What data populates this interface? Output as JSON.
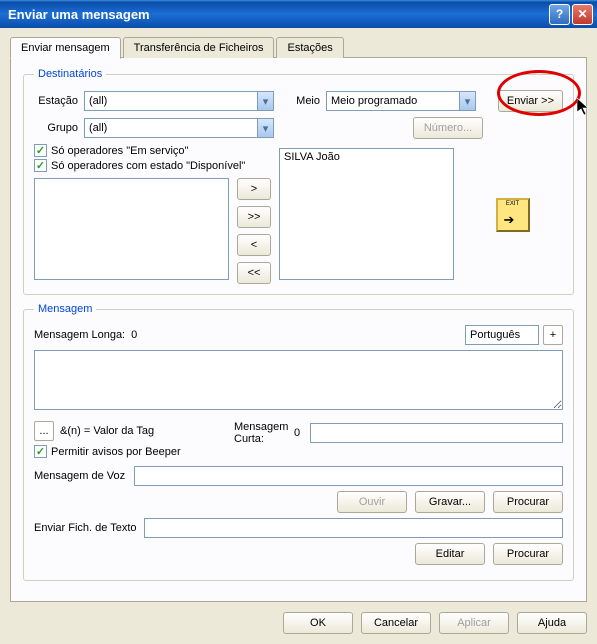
{
  "window": {
    "title": "Enviar uma mensagem"
  },
  "tabs": {
    "send": "Enviar mensagem",
    "transfer": "Transferência de Ficheiros",
    "stations": "Estações"
  },
  "dest": {
    "legend": "Destinatários",
    "station_label": "Estação",
    "station_value": "(all)",
    "group_label": "Grupo",
    "group_value": "(all)",
    "medium_label": "Meio",
    "medium_value": "Meio programado",
    "send_button": "Enviar >>",
    "number_button": "Número...",
    "chk_inservice": "Só operadores \"Em serviço\"",
    "chk_available": "Só operadores com estado \"Disponível\"",
    "move_right": ">",
    "move_all_right": ">>",
    "move_left": "<",
    "move_all_left": "<<",
    "selected_item": "SILVA João"
  },
  "msg": {
    "legend": "Mensagem",
    "long_label": "Mensagem Longa:",
    "long_count": "0",
    "lang": "Português",
    "plus": "+",
    "tag_hint": "&(n) = Valor da Tag",
    "tag_btn": "...",
    "short_label": "Mensagem Curta:",
    "short_count": "0",
    "beeper": "Permitir avisos por Beeper",
    "voice_label": "Mensagem de Voz",
    "listen": "Ouvir",
    "record": "Gravar...",
    "browse": "Procurar",
    "textfile_label": "Enviar Fich. de Texto",
    "edit": "Editar",
    "browse2": "Procurar"
  },
  "footer": {
    "ok": "OK",
    "cancel": "Cancelar",
    "apply": "Aplicar",
    "help": "Ajuda"
  }
}
